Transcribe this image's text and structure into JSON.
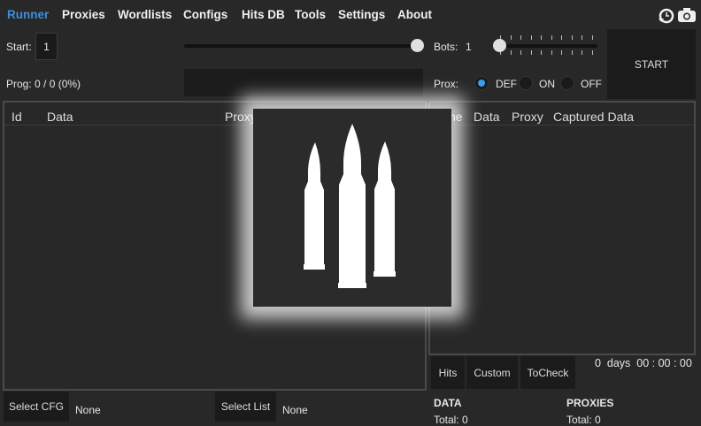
{
  "nav": {
    "tabs": [
      "Runner",
      "Proxies",
      "Wordlists",
      "Configs",
      "Hits DB",
      "Tools",
      "Settings",
      "About"
    ],
    "active": "Runner"
  },
  "runner": {
    "start_label": "Start:",
    "start_value": "1",
    "bots_label": "Bots:",
    "bots_value": "1",
    "start_button": "START",
    "progress_text": "Prog: 0 / 0 (0%)",
    "prox_label": "Prox:",
    "prox_options": [
      "DEF",
      "ON",
      "OFF"
    ],
    "prox_selected": "DEF",
    "accent": "#3d8fe0"
  },
  "left_table": {
    "columns": [
      "Id",
      "Data",
      "Proxy"
    ]
  },
  "right_table": {
    "columns": [
      "Time",
      "Data",
      "Proxy",
      "Captured Data"
    ]
  },
  "result_tabs": [
    "Hits",
    "Custom",
    "ToCheck"
  ],
  "timer": "0  days  00 : 00 : 00",
  "bottom": {
    "select_cfg": "Select CFG",
    "cfg_value": "None",
    "select_list": "Select List",
    "list_value": "None"
  },
  "stats": {
    "data_title": "DATA",
    "data_total": "Total: 0",
    "proxies_title": "PROXIES",
    "proxies_total": "Total: 0"
  }
}
